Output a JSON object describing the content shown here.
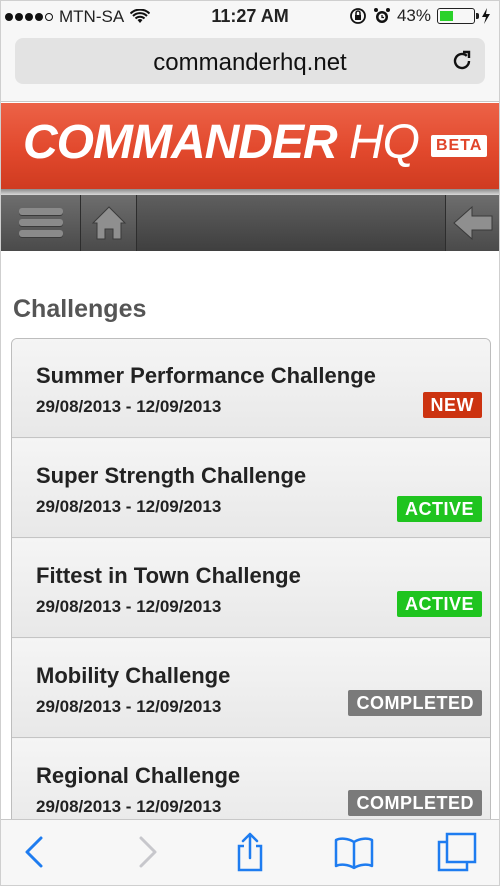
{
  "status_bar": {
    "carrier": "MTN-SA",
    "time": "11:27 AM",
    "battery": "43%",
    "battery_level": 0.43,
    "signal_bars": 4
  },
  "address_bar": {
    "url": "commanderhq.net"
  },
  "banner": {
    "logo_main": "COMMANDER ",
    "logo_hq": "HQ",
    "beta": "BETA",
    "colors": {
      "brand": "#e2492d",
      "beta_text": "#e1452a"
    }
  },
  "nav": {
    "menu_icon": "hamburger-icon",
    "home_icon": "home-icon",
    "back_icon": "back-arrow-icon"
  },
  "page": {
    "heading": "Challenges"
  },
  "challenges": [
    {
      "title": "Summer Performance Challenge",
      "dates": "29/08/2013 - 12/09/2013",
      "status": "NEW",
      "status_color": "#cc3310"
    },
    {
      "title": "Super Strength Challenge",
      "dates": "29/08/2013 - 12/09/2013",
      "status": "ACTIVE",
      "status_color": "#1fc41f"
    },
    {
      "title": "Fittest in Town Challenge",
      "dates": "29/08/2013 - 12/09/2013",
      "status": "ACTIVE",
      "status_color": "#1fc41f"
    },
    {
      "title": "Mobility Challenge",
      "dates": "29/08/2013 - 12/09/2013",
      "status": "COMPLETED",
      "status_color": "#7a7a7a"
    },
    {
      "title": "Regional Challenge",
      "dates": "29/08/2013 - 12/09/2013",
      "status": "COMPLETED",
      "status_color": "#7a7a7a"
    }
  ],
  "toolbar": {
    "icons": [
      "back-icon",
      "forward-icon",
      "share-icon",
      "bookmarks-icon",
      "tabs-icon"
    ],
    "accent": "#1e7cf0"
  }
}
